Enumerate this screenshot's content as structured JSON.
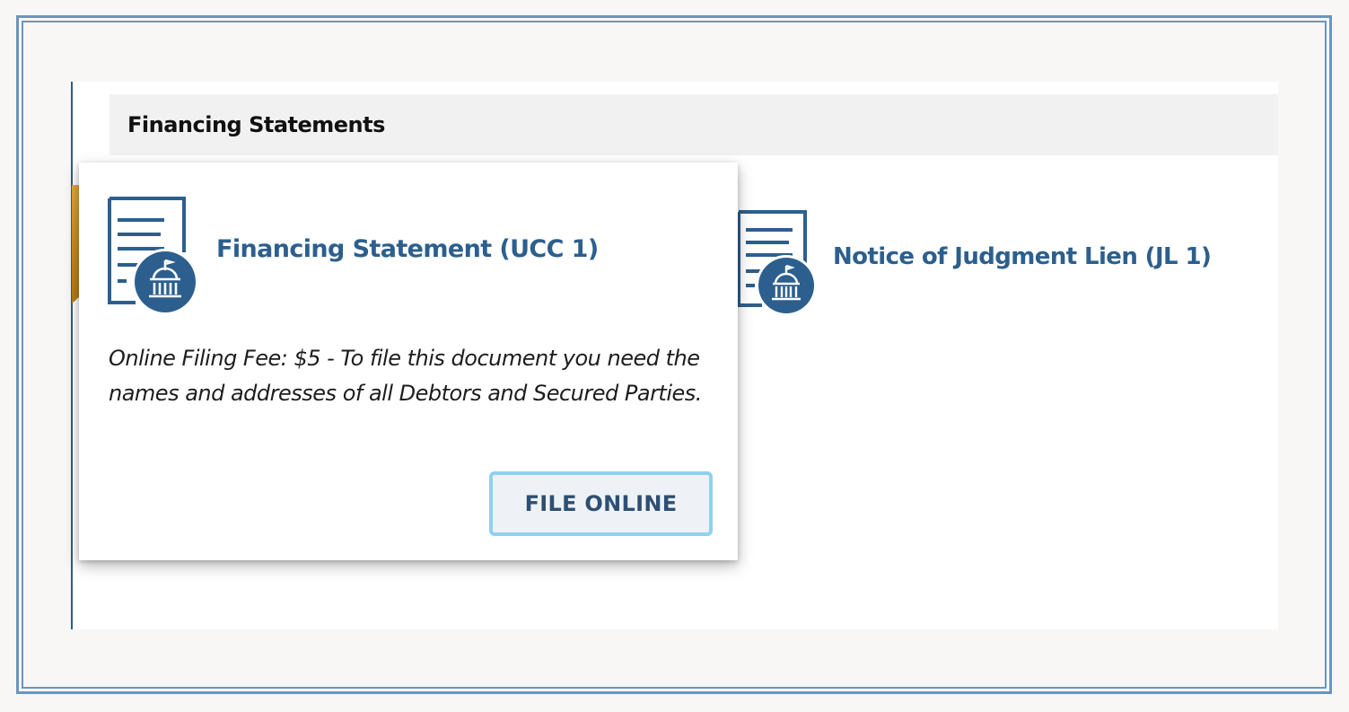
{
  "section": {
    "title": "Financing Statements"
  },
  "cards": [
    {
      "title": "Financing Statement (UCC 1)",
      "description": "Online Filing Fee: $5 - To file this document you need the names and addresses of all Debtors and Secured Parties.",
      "button_label": "FILE ONLINE",
      "icon": "document-capitol-icon",
      "selected": true
    },
    {
      "title": "Notice of Judgment Lien (JL 1)",
      "icon": "document-capitol-icon",
      "selected": false
    }
  ],
  "colors": {
    "accent_blue": "#2c5f8e",
    "button_border": "#8fd1ef",
    "ribbon_gold": "#d69a2a",
    "header_bg": "#f1f1f1"
  }
}
